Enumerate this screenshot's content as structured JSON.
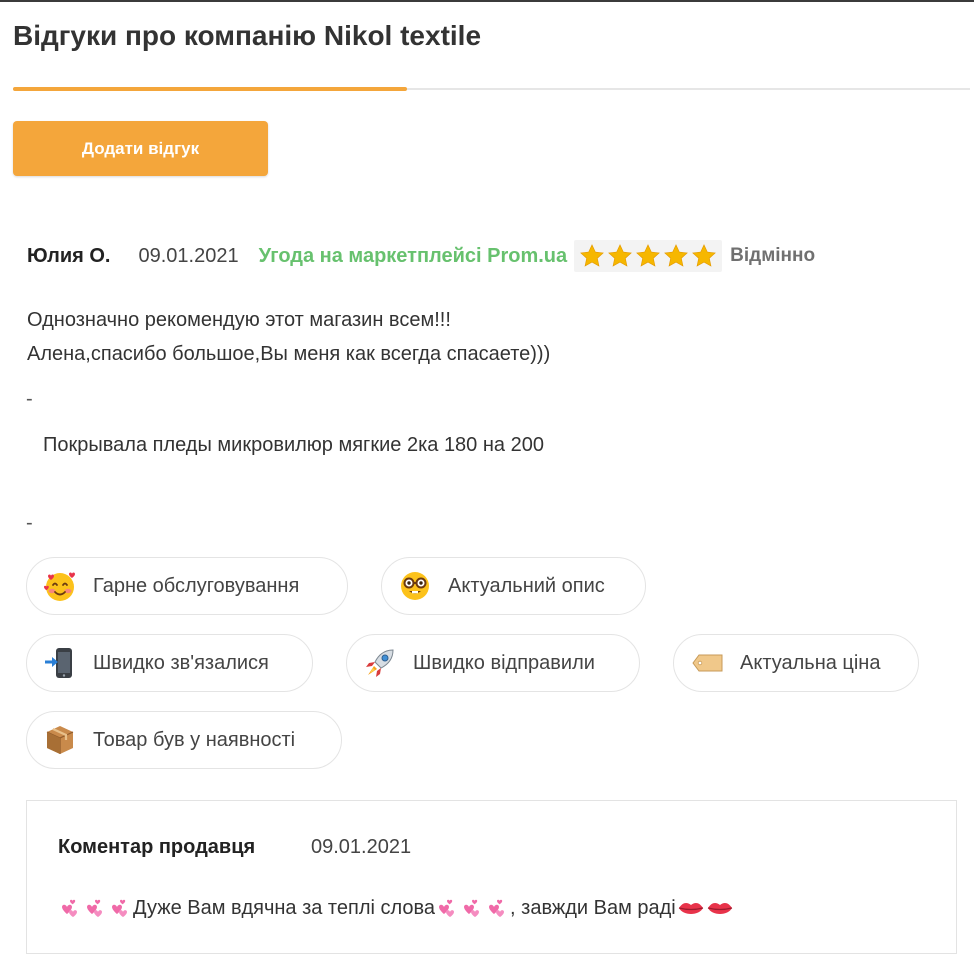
{
  "header": {
    "title": "Відгуки про компанію Nikol textile"
  },
  "actions": {
    "add_review": "Додати відгук"
  },
  "review": {
    "author": "Юлия О.",
    "date": "09.01.2021",
    "deal": "Угода на маркетплейсі Prom.ua",
    "rating": 5,
    "rating_label": "Відмінно",
    "text_line1": "Однозначно рекомендую этот магазин всем!!!",
    "text_line2": "Алена,спасибо большое,Вы меня как всегда спасаете)))",
    "dash": "-",
    "product": "Покрывала пледы микровилюр мягкие 2ка 180 на 200"
  },
  "tags": [
    {
      "label": "Гарне обслуговування",
      "icon": "smiling-face-with-hearts-icon"
    },
    {
      "label": "Актуальний опис",
      "icon": "nerd-face-icon"
    },
    {
      "label": "Швидко зв'язалися",
      "icon": "mobile-phone-arrow-icon"
    },
    {
      "label": "Швидко відправили",
      "icon": "rocket-icon"
    },
    {
      "label": "Актуальна ціна",
      "icon": "price-tag-icon"
    },
    {
      "label": "Товар був у наявності",
      "icon": "package-icon"
    }
  ],
  "seller_reply": {
    "title": "Коментар продавця",
    "date": "09.01.2021",
    "text_main": "Дуже Вам вдячна за теплі слова",
    "text_tail": ", завжди Вам раді"
  },
  "colors": {
    "accent": "#f4a63b",
    "deal_green": "#67c16e",
    "star": "#f6b700"
  }
}
